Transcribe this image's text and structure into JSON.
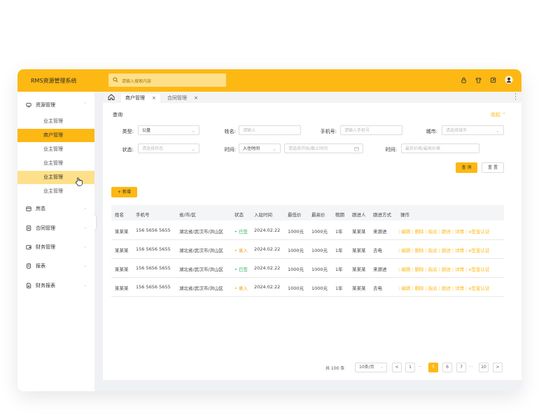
{
  "app": {
    "title": "RMS资源管理系统"
  },
  "search": {
    "placeholder": "请输入搜索内容"
  },
  "sidebar": {
    "groups": [
      {
        "label": "资源管理",
        "icon": "storage-icon"
      },
      {
        "label": "房态",
        "icon": "calendar-icon"
      },
      {
        "label": "合同管理",
        "icon": "contract-icon"
      },
      {
        "label": "财务管理",
        "icon": "wallet-icon"
      },
      {
        "label": "报表",
        "icon": "report-icon"
      },
      {
        "label": "财务报表",
        "icon": "finance-report-icon"
      }
    ],
    "subitems": [
      "业主管理",
      "商户管理",
      "业主管理",
      "业主管理",
      "业主管理",
      "业主管理"
    ]
  },
  "tabs": [
    {
      "label": "商户管理",
      "close": "×"
    },
    {
      "label": "合同管理",
      "close": "×"
    }
  ],
  "query": {
    "section_label": "查询",
    "collapse_label": "收起",
    "type_label": "类型:",
    "type_value": "公盘",
    "name_label": "姓名:",
    "name_placeholder": "请输入",
    "phone_label": "手机号:",
    "phone_placeholder": "请输入手机号",
    "city_label": "城市:",
    "city_placeholder": "请选择城市",
    "status_label": "状态:",
    "status_placeholder": "请选择状态",
    "time_label": "时间:",
    "time_type_value": "入住时间",
    "time_range_placeholder": "请选择开始/截止时间",
    "time2_label": "时间:",
    "price_placeholder": "最后价格/最高价格",
    "query_button": "查 询",
    "reset_button": "重 置"
  },
  "add_button": "+ 新增",
  "table": {
    "columns": [
      "姓名",
      "手机号",
      "省/市/区",
      "状态",
      "入驻时间",
      "最低价",
      "最高价",
      "租期",
      "跟进人",
      "跟进方式",
      "操作"
    ],
    "rows": [
      {
        "name": "某某某",
        "phone": "156 5656 5655",
        "region": "湖北省/武汉市/洪山区",
        "status": "• 已签",
        "status_type": "signed",
        "date": "2024.02.22",
        "min": "1000元",
        "max": "1000元",
        "term": "1年",
        "follower": "某某某",
        "method": "来源进"
      },
      {
        "name": "某某某",
        "phone": "156 5656 5655",
        "region": "湖北省/武汉市/洪山区",
        "status": "• 录入",
        "status_type": "entered",
        "date": "2024.02.22",
        "min": "1000元",
        "max": "1000元",
        "term": "1年",
        "follower": "某某某",
        "method": "去电"
      },
      {
        "name": "某某某",
        "phone": "156 5656 5655",
        "region": "湖北省/武汉市/洪山区",
        "status": "• 已签",
        "status_type": "signed",
        "date": "2024.02.22",
        "min": "1000元",
        "max": "1000元",
        "term": "1年",
        "follower": "某某某",
        "method": "来源进"
      },
      {
        "name": "某某某",
        "phone": "156 5656 5655",
        "region": "湖北省/武汉市/洪山区",
        "status": "• 录入",
        "status_type": "entered",
        "date": "2024.02.22",
        "min": "1000元",
        "max": "1000元",
        "term": "1年",
        "follower": "某某某",
        "method": "去电"
      }
    ],
    "actions": [
      "编辑",
      "删除",
      "指派",
      "跟进",
      "详情",
      "e签宝认证"
    ]
  },
  "pagination": {
    "total": "共 100 条",
    "page_size": "10条/页",
    "prev": "<",
    "next": ">",
    "pages": [
      "1",
      "5",
      "6",
      "7",
      "10"
    ],
    "ellipsis": "···",
    "current": "5"
  },
  "colors": {
    "accent": "#fdb813",
    "signed": "#2db45a",
    "entered": "#f0a020"
  }
}
